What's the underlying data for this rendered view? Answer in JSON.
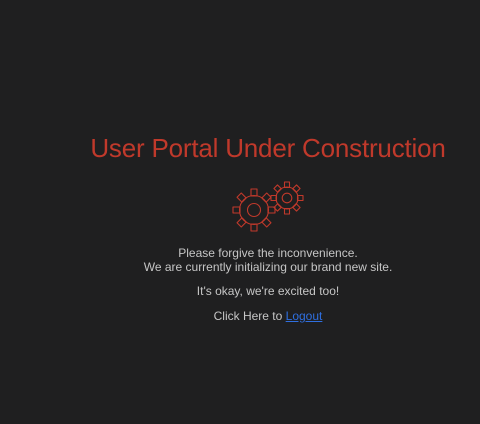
{
  "heading": "User Portal Under Construction",
  "icon": "gears-icon",
  "colors": {
    "background": "#1f1f20",
    "accent": "#c0392b",
    "text": "#c6c6c6",
    "link": "#2f6fe0"
  },
  "message": {
    "line1": "Please forgive the inconvenience.",
    "line2": "We are currently initializing our brand new site.",
    "line3": "It's okay, we're excited too!",
    "logout_prefix": "Click Here to",
    "logout_link": "Logout"
  }
}
